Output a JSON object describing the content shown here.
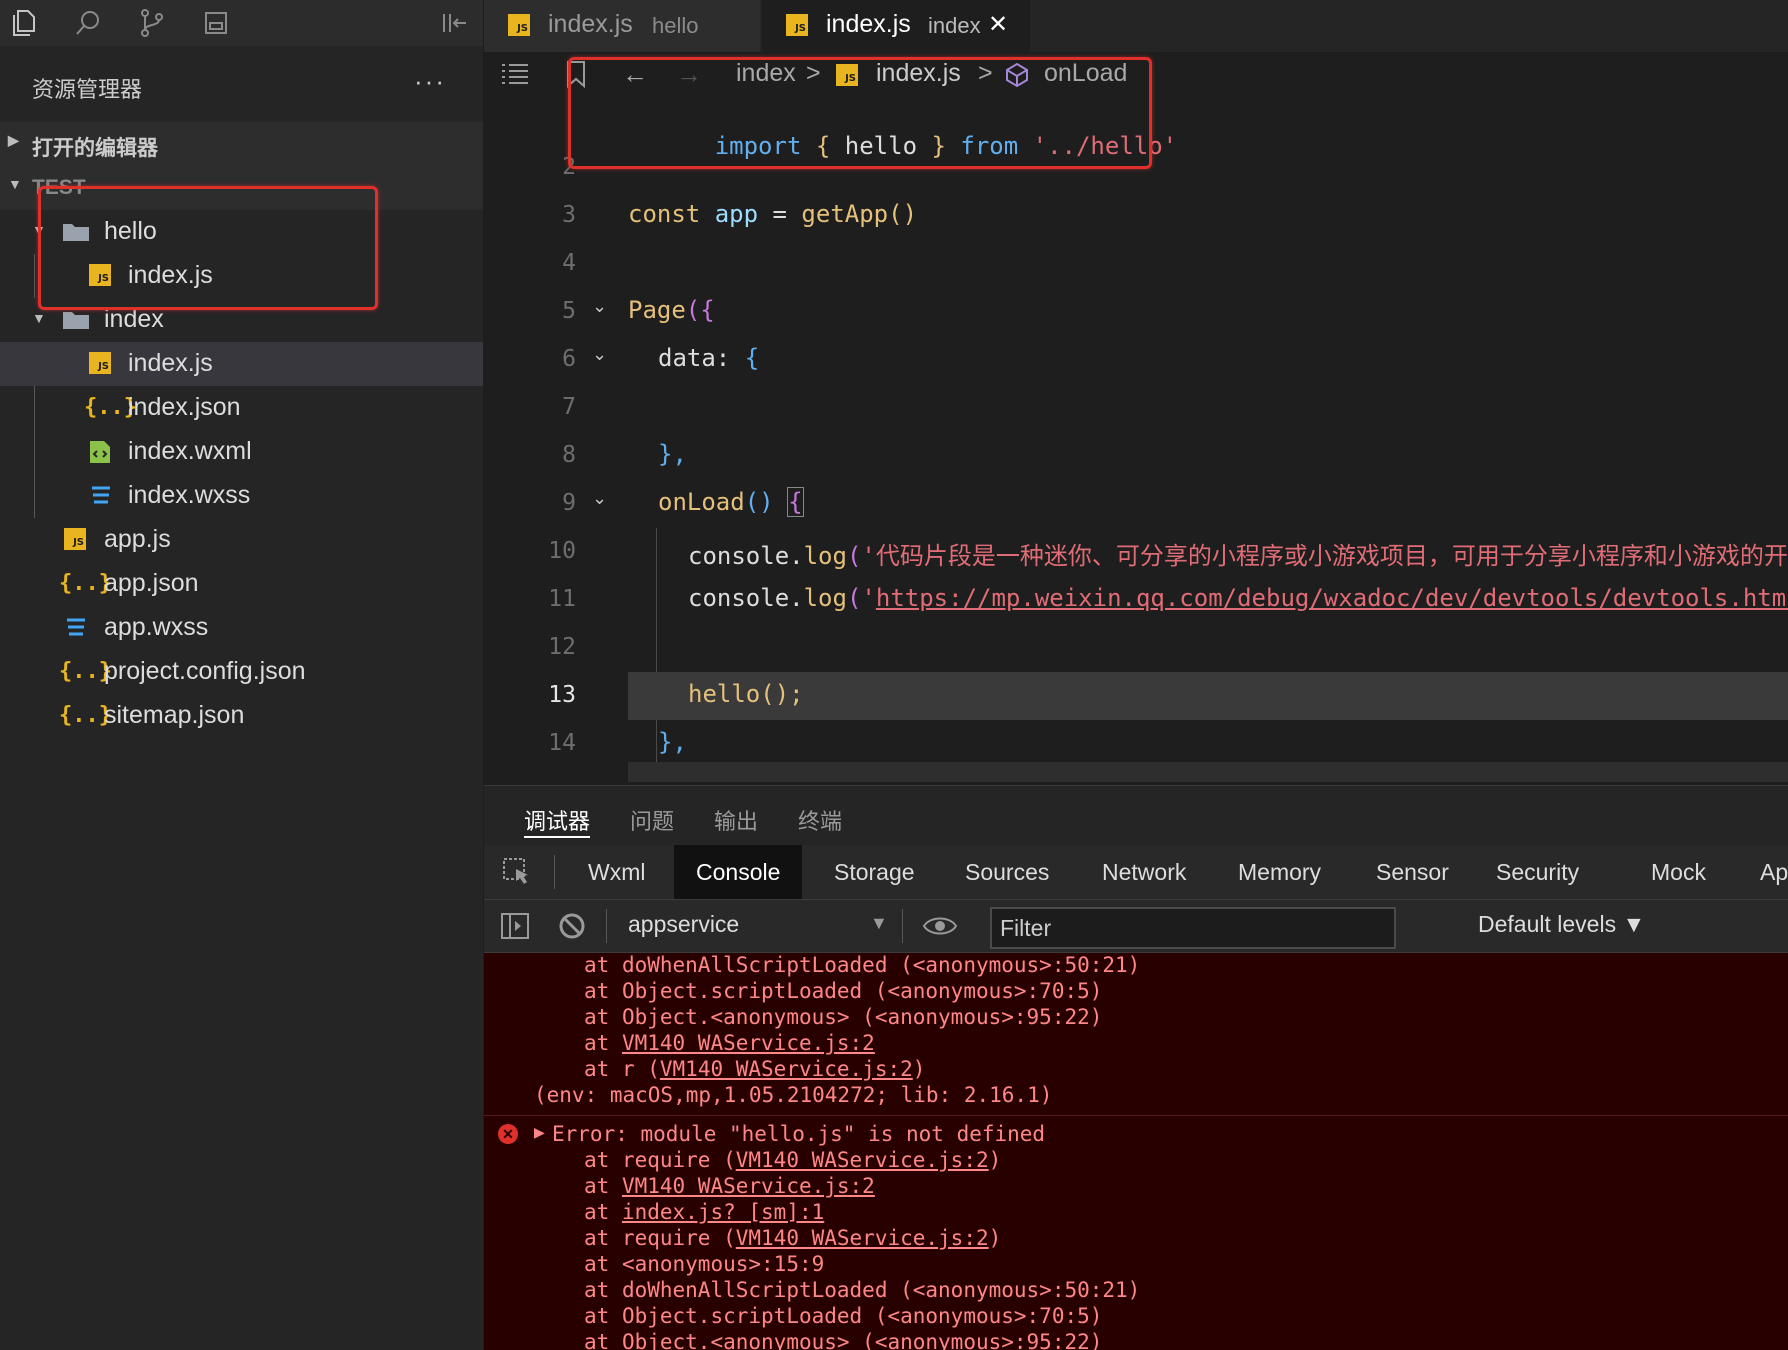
{
  "activity": {
    "icons": [
      "files-icon",
      "search-icon",
      "source-control-icon",
      "save-icon",
      "collapse-panel-icon"
    ]
  },
  "sidebar": {
    "title": "资源管理器",
    "more": "···",
    "section_open_editors": "打开的编辑器",
    "section_project": "TEST",
    "tree": [
      {
        "label": "hello",
        "type": "folder"
      },
      {
        "label": "index.js",
        "type": "js"
      },
      {
        "label": "index",
        "type": "folder"
      },
      {
        "label": "index.js",
        "type": "js"
      },
      {
        "label": "index.json",
        "type": "json"
      },
      {
        "label": "index.wxml",
        "type": "wxml"
      },
      {
        "label": "index.wxss",
        "type": "wxss"
      },
      {
        "label": "app.js",
        "type": "js"
      },
      {
        "label": "app.json",
        "type": "json"
      },
      {
        "label": "app.wxss",
        "type": "wxss"
      },
      {
        "label": "project.config.json",
        "type": "json"
      },
      {
        "label": "sitemap.json",
        "type": "json"
      }
    ]
  },
  "tabs": [
    {
      "name": "index.js",
      "desc": "hello",
      "active": false
    },
    {
      "name": "index.js",
      "desc": "index",
      "active": true,
      "close": "✕"
    }
  ],
  "breadcrumb": {
    "folder": "index",
    "file": "index.js",
    "symbol": "onLoad",
    "sep": ">"
  },
  "code": {
    "line1": {
      "import": "import",
      "open": "{",
      "name": "hello",
      "close": "}",
      "from": "from",
      "path": "'../hello'"
    },
    "line_numbers": [
      "2",
      "3",
      "4",
      "5",
      "6",
      "7",
      "8",
      "9",
      "10",
      "11",
      "12",
      "13",
      "14"
    ],
    "line3": {
      "const": "const",
      "var": "app",
      "eq": "=",
      "fn": "getApp",
      "parens": "()"
    },
    "line5": {
      "fn": "Page",
      "open": "({"
    },
    "line6": {
      "key": "data:",
      "open": "{"
    },
    "line8": {
      "text": "},"
    },
    "line9": {
      "fn": "onLoad",
      "parens": "()",
      "open": "{"
    },
    "line10": {
      "obj": "console",
      "dot": ".",
      "method": "log",
      "paren": "(",
      "str": "'代码片段是一种迷你、可分享的小程序或小游戏项目，可用于分享小程序和小游戏的开"
    },
    "line11": {
      "obj": "console",
      "dot": ".",
      "method": "log",
      "paren": "(",
      "quote": "'",
      "url": "https://mp.weixin.qq.com/debug/wxadoc/dev/devtools/devtools.html"
    },
    "line13": {
      "call": "hello();"
    },
    "line14": {
      "text": "},"
    }
  },
  "panel": {
    "tabs": [
      "调试器",
      "问题",
      "输出",
      "终端"
    ],
    "devtools_tabs": [
      "Wxml",
      "Console",
      "Storage",
      "Sources",
      "Network",
      "Memory",
      "Sensor",
      "Security",
      "Mock",
      "Ap"
    ],
    "context": "appservice",
    "filter_placeholder": "Filter",
    "levels": "Default levels ▼"
  },
  "console": {
    "block1": [
      {
        "at": "at",
        "text": "doWhenAllScriptLoaded (<anonymous>:50:21)"
      },
      {
        "at": "at",
        "text": "Object.scriptLoaded (<anonymous>:70:5)"
      },
      {
        "at": "at",
        "text": "Object.<anonymous> (<anonymous>:95:22)"
      },
      {
        "at": "at",
        "link": "VM140 WAService.js:2"
      },
      {
        "at": "at",
        "pre": "r (",
        "link": "VM140 WAService.js:2",
        "post": ")"
      }
    ],
    "env": "(env: macOS,mp,1.05.2104272; lib: 2.16.1)",
    "error_title": "Error: module \"hello.js\" is not defined",
    "block2": [
      {
        "at": "at",
        "pre": "require (",
        "link": "VM140 WAService.js:2",
        "post": ")"
      },
      {
        "at": "at",
        "link": "VM140 WAService.js:2"
      },
      {
        "at": "at",
        "link": "index.js? [sm]:1"
      },
      {
        "at": "at",
        "pre": "require (",
        "link": "VM140 WAService.js:2",
        "post": ")"
      },
      {
        "at": "at",
        "text": "<anonymous>:15:9"
      },
      {
        "at": "at",
        "text": "doWhenAllScriptLoaded (<anonymous>:50:21)"
      },
      {
        "at": "at",
        "text": "Object.scriptLoaded (<anonymous>:70:5)"
      },
      {
        "at": "at",
        "text": "Object.<anonymous> (<anonymous>:95:22)"
      }
    ]
  }
}
